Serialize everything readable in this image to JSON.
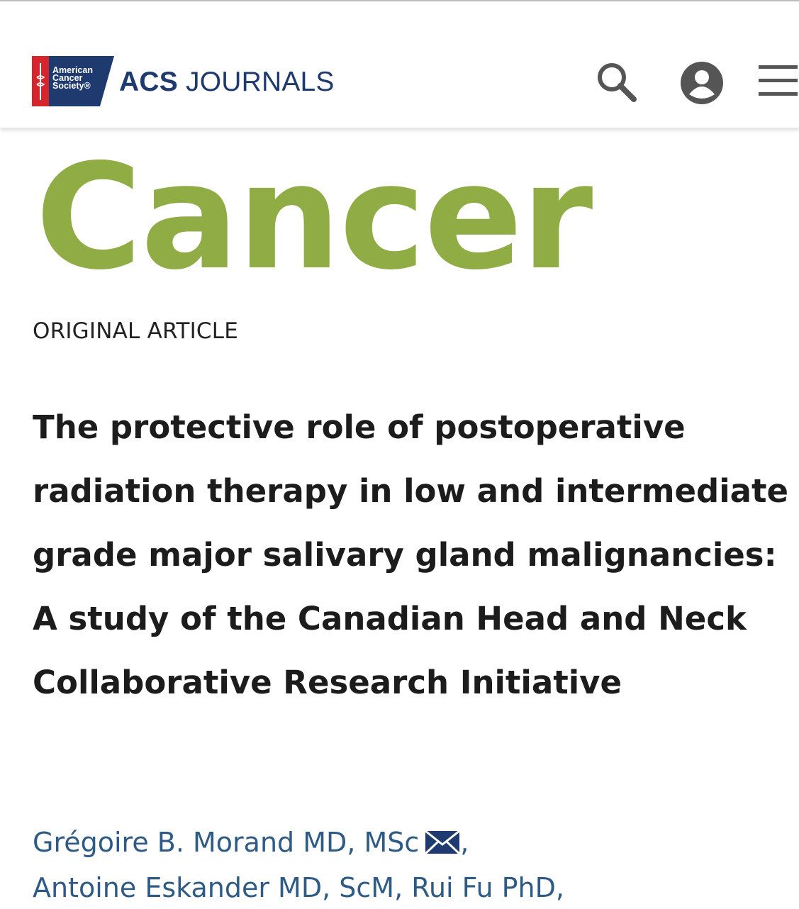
{
  "header": {
    "badge": {
      "line1": "American",
      "line2": "Cancer",
      "line3": "Society®",
      "color": "#d5262d",
      "stripe_color": "#1f3a6f"
    },
    "site_title_strong": "ACS",
    "site_title_light": "JOURNALS",
    "title_color": "#1f3a6f",
    "icons": [
      "search-icon",
      "account-icon",
      "menu-icon"
    ]
  },
  "journal": {
    "name": "Cancer",
    "color": "#8fac45"
  },
  "article": {
    "type": "ORIGINAL ARTICLE",
    "title": "The protective role of postoperative radiation therapy in low and intermediate grade major salivary gland malignancies: A study of the Canadian Head and Neck Collaborative Research Initiative"
  },
  "authors": {
    "link_color": "#2e5b86",
    "list": [
      {
        "name": "Grégoire B. Morand MD, MSc",
        "corresponding": true
      },
      {
        "name": "Antoine Eskander MD, ScM",
        "corresponding": false
      },
      {
        "name": "Rui Fu PhD",
        "corresponding": false
      }
    ],
    "separator": ","
  }
}
